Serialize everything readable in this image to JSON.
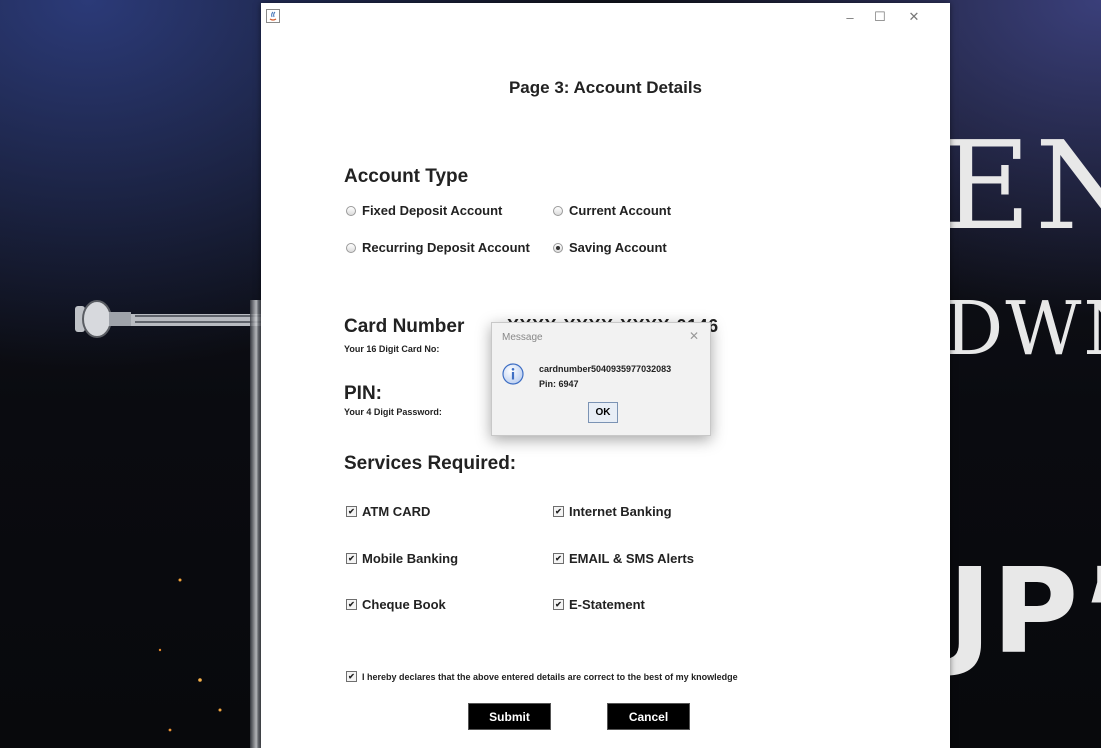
{
  "background": {
    "text_line_1": "EN",
    "text_line_2": "DWN",
    "text_line_3": "JP”"
  },
  "window": {
    "icon": "java-app-icon",
    "minimize": "–",
    "maximize": "☐",
    "close": "✕"
  },
  "page": {
    "title": "Page 3: Account Details"
  },
  "account_type": {
    "heading": "Account Type",
    "options": [
      {
        "label": "Fixed Deposit Account",
        "selected": false
      },
      {
        "label": "Current Account",
        "selected": false
      },
      {
        "label": "Recurring Deposit Account",
        "selected": false
      },
      {
        "label": "Saving Account",
        "selected": true
      }
    ]
  },
  "card": {
    "heading": "Card Number",
    "hint": "Your 16 Digit Card No:",
    "value": "XXXX-XXXX-XXXX-0146"
  },
  "pin": {
    "heading": "PIN:",
    "hint": "Your 4 Digit Password:"
  },
  "services": {
    "heading": "Services Required:",
    "options": [
      {
        "label": "ATM CARD",
        "checked": true
      },
      {
        "label": "Internet Banking",
        "checked": true
      },
      {
        "label": "Mobile Banking",
        "checked": true
      },
      {
        "label": "EMAIL & SMS Alerts",
        "checked": true
      },
      {
        "label": "Cheque Book",
        "checked": true
      },
      {
        "label": "E-Statement",
        "checked": true
      }
    ]
  },
  "declaration": {
    "label": "I hereby declares that the above entered details are correct to the best of my knowledge",
    "checked": true
  },
  "buttons": {
    "submit": "Submit",
    "cancel": "Cancel"
  },
  "dialog": {
    "title": "Message",
    "close": "✕",
    "icon": "info-icon",
    "line_1": "cardnumber5040935977032083",
    "line_2": "Pin: 6947",
    "ok": "OK"
  },
  "colors": {
    "window_bg": "#ffffff",
    "button_dark": "#000000",
    "dialog_bg": "#f2f2f2",
    "info_blue": "#3f6fc4"
  }
}
